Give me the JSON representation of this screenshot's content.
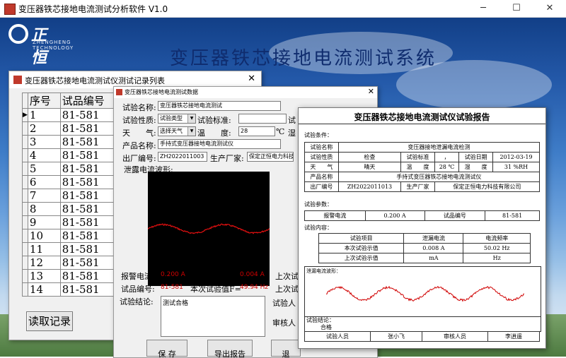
{
  "window": {
    "title": "变压器铁芯接地电流测试分析软件 V1.0",
    "min": "─",
    "max": "☐",
    "close": "✕"
  },
  "logo": {
    "name": "正恒科技",
    "en": "ZHENGHENG TECHNOLOGY"
  },
  "system_title": "变压器铁芯接地电流测试系统",
  "list_window": {
    "title": "变压器铁芯接地电流测试仪测试记录列表",
    "close": "✕",
    "columns": [
      "序号",
      "试品编号"
    ],
    "rows": [
      {
        "no": "1",
        "id": "81-581"
      },
      {
        "no": "2",
        "id": "81-581"
      },
      {
        "no": "3",
        "id": "81-581"
      },
      {
        "no": "4",
        "id": "81-581"
      },
      {
        "no": "5",
        "id": "81-581"
      },
      {
        "no": "6",
        "id": "81-581"
      },
      {
        "no": "7",
        "id": "81-581"
      },
      {
        "no": "8",
        "id": "81-581"
      },
      {
        "no": "9",
        "id": "81-581"
      },
      {
        "no": "10",
        "id": "81-581"
      },
      {
        "no": "11",
        "id": "81-581"
      },
      {
        "no": "12",
        "id": "81-581"
      },
      {
        "no": "13",
        "id": "81-581"
      },
      {
        "no": "14",
        "id": "81-581"
      }
    ],
    "read_button": "读取记录"
  },
  "data_window": {
    "title": "变压器铁芯接地电流测试数据",
    "close": "✕",
    "test_name_label": "试验名称:",
    "test_name_value": "变压器铁芯接地电流测试",
    "test_nature_label": "试验性质:",
    "test_nature_value": "试验类型",
    "test_standard_label": "试验标准:",
    "test_standard_value": "",
    "cut_label_1": "试",
    "weather_label": "天　　气:",
    "weather_value": "选择天气",
    "temp_label": "温　　度:",
    "temp_value": "28",
    "temp_unit": "℃",
    "cut_label_2": "湿",
    "product_label": "产品名称:",
    "product_value": "手持式变压器接地电流测试仪",
    "serial_label": "出厂编号:",
    "serial_value": "ZH2022011003",
    "maker_label": "生产厂家:",
    "maker_value": "保定正恒电力科技",
    "waveform_label": "泄露电流波形:",
    "alarm_label": "报警电流:",
    "alarm_value": "0.200 A",
    "current_label": "本次试验值I=",
    "current_value": "0.004 A",
    "cut_label_3": "上次试",
    "sample_label": "试品编号:",
    "sample_value": "81-581",
    "freq_label": "本次试验值F=",
    "freq_value": "49.94 Hz",
    "cut_label_4": "上次试",
    "conclusion_label": "试验结论:",
    "conclusion_value": "测试合格",
    "tester_label": "试验人",
    "reviewer_label": "审核人",
    "save_button": "保 存",
    "export_button": "导出报告",
    "cut_button": "退"
  },
  "report": {
    "title": "变压器铁芯接地电流测试仪试验报告",
    "cond_label": "试验条件：",
    "test_name_label": "试验名称",
    "test_name_value": "变压器接地泄漏电流检测",
    "nature_label": "试验性质",
    "nature_value": "检查",
    "standard_label": "试验标准",
    "standard_value": "，",
    "date_label": "试验日期",
    "date_value": "2012-03-19",
    "weather_label": "天　　气",
    "weather_value": "晴天",
    "temp_label": "温　　度",
    "temp_value": "28 ℃",
    "humid_label": "湿　　度",
    "humid_value": "31 %RH",
    "product_label": "产品名称",
    "product_value": "手持式变压器铁芯接地电流测试仪",
    "serial_label": "出厂编号",
    "serial_value": "ZH2022011013",
    "maker_label": "生产厂家",
    "maker_value": "保定正恒电力科技有限公司",
    "params_label": "试验参数：",
    "alarm_label": "报警电流",
    "alarm_value": "0.200 A",
    "sample_label": "试品编号",
    "sample_value": "81-581",
    "content_label": "试验内容：",
    "item_label": "试验项目",
    "item_col1": "泄漏电流",
    "item_col2": "电流频率",
    "current_label": "本次试验示值",
    "current_value": "0.008 A",
    "current_freq": "50.02 Hz",
    "last_label": "上次试验示值",
    "last_value": "mA",
    "last_freq": "Hz",
    "wave_label": "泄漏电流波形：",
    "conclusion_label": "试验结论：",
    "conclusion_value": "合格",
    "tester_label": "试验人员",
    "tester_value": "张小飞",
    "reviewer_label": "审核人员",
    "reviewer_value": "李逍遥"
  }
}
